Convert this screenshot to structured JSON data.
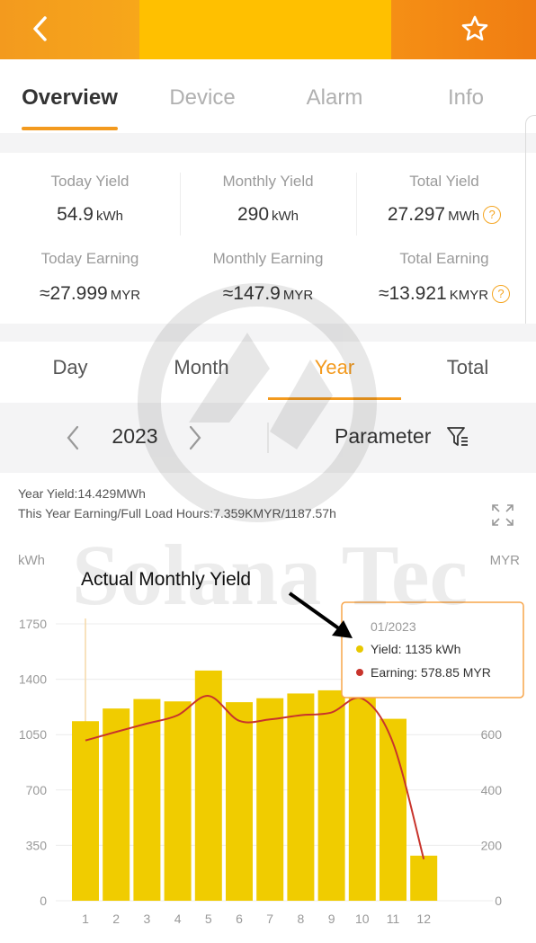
{
  "header": {
    "back_icon": "chevron-left-icon",
    "favorite_icon": "star-icon",
    "colors": {
      "orange": "#f39a1e",
      "yellow": "#ffc000"
    }
  },
  "tabs": [
    {
      "label": "Overview",
      "active": true
    },
    {
      "label": "Device",
      "active": false
    },
    {
      "label": "Alarm",
      "active": false
    },
    {
      "label": "Info",
      "active": false
    }
  ],
  "stats": {
    "today_yield": {
      "label": "Today Yield",
      "value": "54.9",
      "unit": "kWh"
    },
    "monthly_yield": {
      "label": "Monthly Yield",
      "value": "290",
      "unit": "kWh"
    },
    "total_yield": {
      "label": "Total Yield",
      "value": "27.297",
      "unit": "MWh"
    },
    "today_earning": {
      "label": "Today Earning",
      "value": "≈27.999",
      "unit": "MYR"
    },
    "monthly_earning": {
      "label": "Monthly Earning",
      "value": "≈147.9",
      "unit": "MYR"
    },
    "total_earning": {
      "label": "Total Earning",
      "value": "≈13.921",
      "unit": "KMYR"
    },
    "help_glyph": "?"
  },
  "period_tabs": [
    {
      "label": "Day",
      "active": false
    },
    {
      "label": "Month",
      "active": false
    },
    {
      "label": "Year",
      "active": true
    },
    {
      "label": "Total",
      "active": false
    }
  ],
  "year_selector": {
    "year": "2023",
    "parameter_label": "Parameter"
  },
  "chart_info": {
    "year_yield": "Year Yield:14.429MWh",
    "earning_hours": "This Year Earning/Full Load Hours:7.359KMYR/1187.57h"
  },
  "annotation": "Actual Monthly Yield",
  "watermark": "Solana Tec",
  "tooltip": {
    "title": "01/2023",
    "yield_label": "Yield:",
    "yield_value": "1135 kWh",
    "earning_label": "Earning:",
    "earning_value": "578.85 MYR"
  },
  "chart_data": {
    "type": "bar",
    "categories": [
      "1",
      "2",
      "3",
      "4",
      "5",
      "6",
      "7",
      "8",
      "9",
      "10",
      "11",
      "12"
    ],
    "series": [
      {
        "type": "bar",
        "color": "#f0cc00",
        "axis": "left",
        "values": [
          1135,
          1215,
          1275,
          1260,
          1455,
          1255,
          1280,
          1310,
          1330,
          1285,
          1150,
          285
        ]
      },
      {
        "type": "line",
        "color": "#c8342c",
        "axis": "right",
        "values": [
          578.85,
          610,
          640,
          670,
          740,
          650,
          655,
          670,
          680,
          730,
          570,
          150
        ]
      }
    ],
    "ylabel": "kWh",
    "y2label": "MYR",
    "ylim": [
      0,
      1750
    ],
    "y2lim": [
      0,
      1000
    ],
    "yticks": [
      0,
      350,
      700,
      1050,
      1400,
      1750
    ],
    "y2ticks": [
      0,
      200,
      400,
      600,
      800,
      1000
    ],
    "highlighted_category": "1"
  }
}
